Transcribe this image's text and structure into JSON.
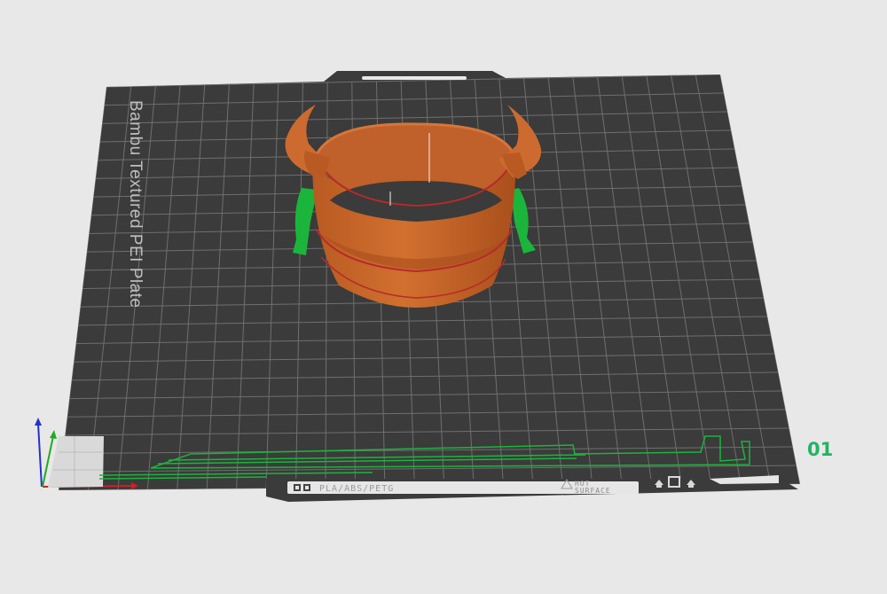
{
  "plate": {
    "label": "Bambu Textured PEI Plate",
    "number": "01",
    "material_text": "PLA/ABS/PETG",
    "surface_line1": "HOT",
    "surface_line2": "SURFACE"
  },
  "icons": {
    "axes": "xyz-axes-icon",
    "warning": "warning-triangle-icon",
    "qr": "qr-code-icon",
    "surface_symbols": "plate-orientation-icons"
  },
  "colors": {
    "background": "#e8e8e8",
    "plate": "#3a3b3a",
    "grid": "#9a9a9a",
    "model": "#c8662c",
    "support": "#1bb53c",
    "plate_number": "#21b463"
  }
}
